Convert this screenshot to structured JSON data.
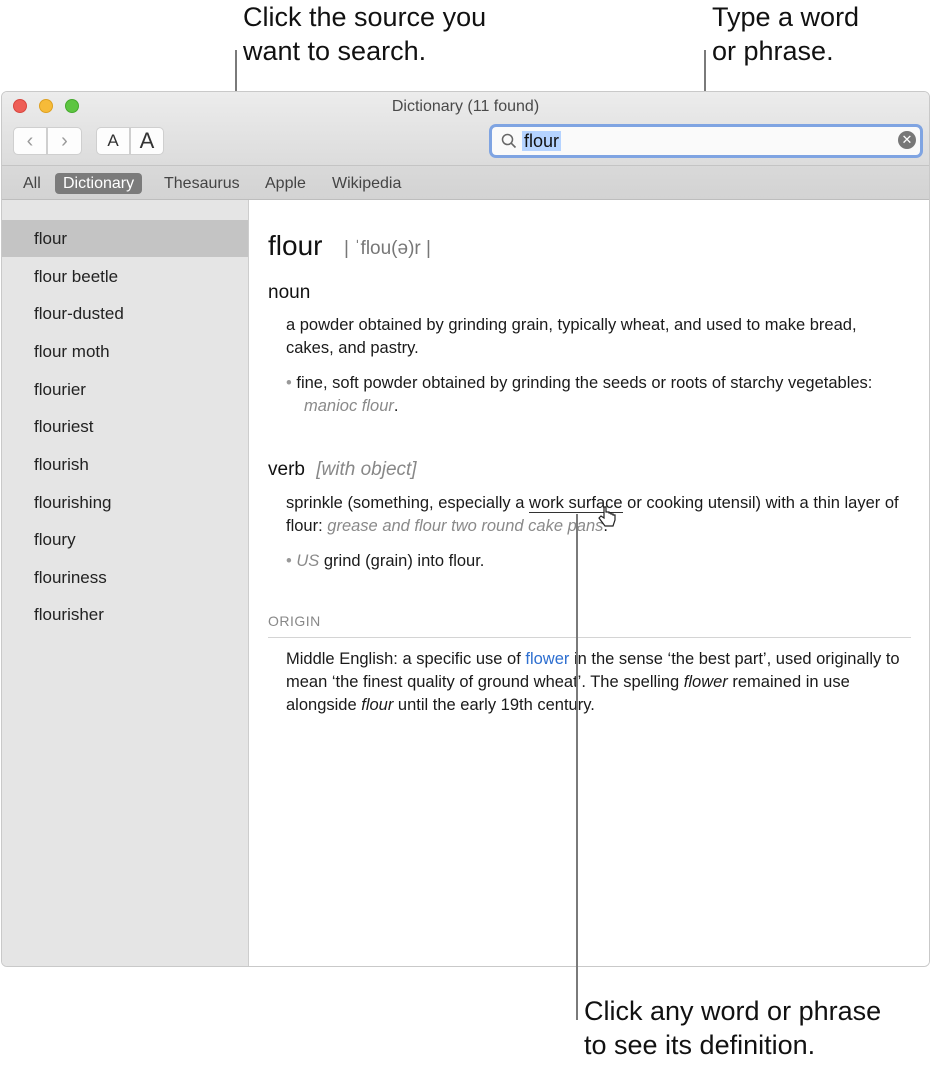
{
  "callouts": {
    "source": [
      "Click the source you",
      "want to search."
    ],
    "search": [
      "Type a word",
      "or phrase."
    ],
    "definition": [
      "Click any word or phrase",
      "to see its definition."
    ]
  },
  "window": {
    "title": "Dictionary (11 found)",
    "traffic_lights": {
      "close": "#ee5e56",
      "minimize": "#f6bb39",
      "zoom": "#5dc541"
    }
  },
  "toolbar": {
    "back_icon": "‹",
    "forward_icon": "›",
    "font_smaller": "A",
    "font_larger": "A"
  },
  "search": {
    "icon": "search-icon",
    "value": "flour",
    "clear_icon": "✕"
  },
  "scopes": [
    {
      "label": "All",
      "active": false
    },
    {
      "label": "Dictionary",
      "active": true
    },
    {
      "label": "Thesaurus",
      "active": false
    },
    {
      "label": "Apple",
      "active": false
    },
    {
      "label": "Wikipedia",
      "active": false
    }
  ],
  "results": [
    "flour",
    "flour beetle",
    "flour-dusted",
    "flour moth",
    "flourier",
    "flouriest",
    "flourish",
    "flourishing",
    "floury",
    "flouriness",
    "flourisher"
  ],
  "entry": {
    "headword": "flour",
    "pronunciation": "| ˈflou(ə)r |",
    "noun": {
      "label": "noun",
      "def1": "a powder obtained by grinding grain, typically wheat, and used to make bread, cakes, and pastry.",
      "sub_bullet": "•",
      "def2": "fine, soft powder obtained by grinding the seeds or roots of starchy vegetables: ",
      "def2_example": "manioc flour",
      "def2_end": "."
    },
    "verb": {
      "label": "verb",
      "grammar": "[with object]",
      "def1_a": "sprinkle (something, especially a ",
      "def1_link": "work surface",
      "def1_b": " or cooking utensil) with a thin layer of flour: ",
      "def1_example": "grease and flour two round cake pans",
      "def1_end": ".",
      "sub_bullet": "•",
      "def2_region": "US",
      "def2": " grind (grain) into flour."
    },
    "origin": {
      "label": "ORIGIN",
      "a": "Middle English: a specific use of ",
      "link": "flower",
      "b": " in the sense ‘the best part’, used originally to mean ‘the finest quality of ground wheat’. The spelling ",
      "it1": "flower",
      "c": " remained in use alongside ",
      "it2": "flour",
      "d": " until the early 19th century."
    }
  }
}
